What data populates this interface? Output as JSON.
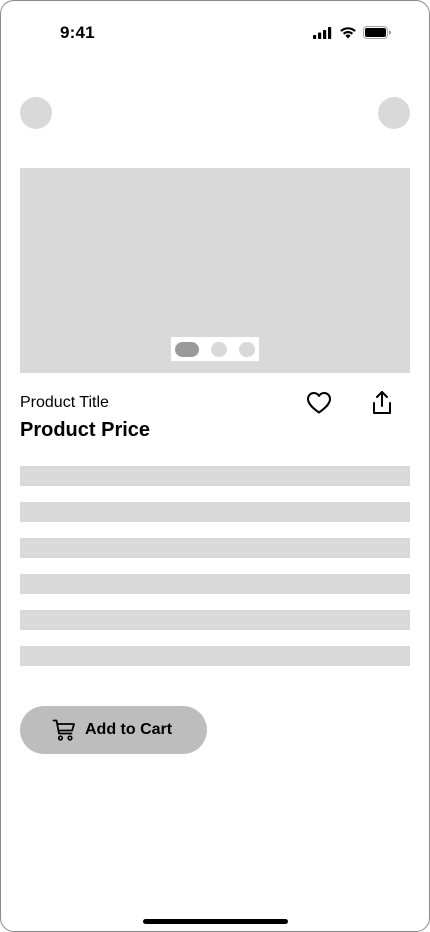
{
  "status_bar": {
    "time": "9:41",
    "icons": [
      "signal-icon",
      "wifi-icon",
      "battery-icon"
    ]
  },
  "nav": {
    "back_icon": "circle-placeholder-icon",
    "menu_icon": "circle-placeholder-icon"
  },
  "gallery": {
    "image_count": 3,
    "active_index": 0
  },
  "product": {
    "title": "Product Title",
    "price": "Product Price",
    "favorite_icon": "heart-icon",
    "share_icon": "share-icon"
  },
  "description": {
    "placeholder_line_count": 6
  },
  "actions": {
    "add_to_cart_label": "Add to Cart",
    "add_to_cart_icon": "cart-icon"
  },
  "colors": {
    "placeholder": "#d9d9d9",
    "button_bg": "#bdbdbd",
    "active_dot": "#9a9a9a",
    "text": "#000000"
  }
}
